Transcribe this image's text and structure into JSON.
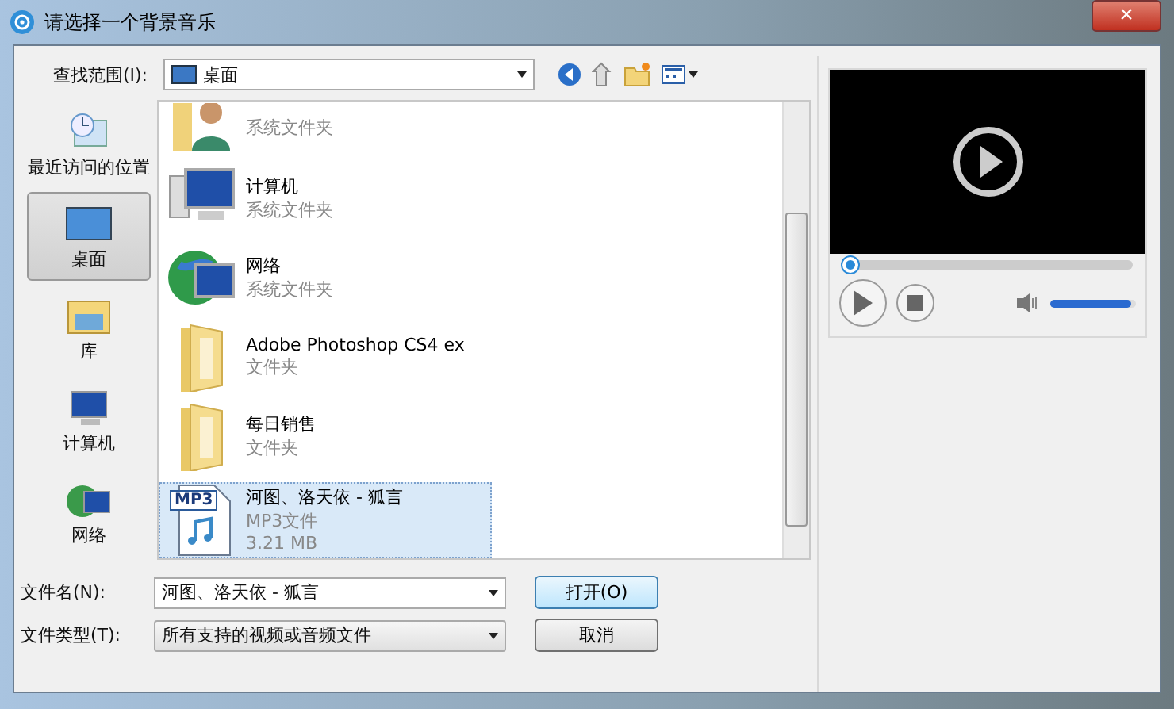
{
  "window": {
    "title": "请选择一个背景音乐",
    "close": "×"
  },
  "look_in": {
    "label": "查找范围(I):",
    "value": "桌面"
  },
  "sidebar": {
    "items": [
      {
        "label": "最近访问的位置",
        "kind": "recent",
        "selected": false
      },
      {
        "label": "桌面",
        "kind": "desktop",
        "selected": true
      },
      {
        "label": "库",
        "kind": "library",
        "selected": false
      },
      {
        "label": "计算机",
        "kind": "computer",
        "selected": false
      },
      {
        "label": "网络",
        "kind": "network",
        "selected": false
      }
    ]
  },
  "files": [
    {
      "kind": "user",
      "subtitle": "系统文件夹",
      "selected": false
    },
    {
      "kind": "computer",
      "name": "计算机",
      "subtitle": "系统文件夹",
      "selected": false
    },
    {
      "kind": "network",
      "name": "网络",
      "subtitle": "系统文件夹",
      "selected": false
    },
    {
      "kind": "folder",
      "name": "Adobe Photoshop CS4 ex",
      "subtitle": "文件夹",
      "selected": false
    },
    {
      "kind": "folder",
      "name": "每日销售",
      "subtitle": "文件夹",
      "selected": false
    },
    {
      "kind": "mp3",
      "name": "河图、洛天依 - 狐言",
      "subtitle": "MP3文件",
      "size": "3.21 MB",
      "badge": "MP3",
      "selected": true
    }
  ],
  "file_name": {
    "label": "文件名(N):",
    "value": "河图、洛天依 - 狐言"
  },
  "file_type": {
    "label": "文件类型(T):",
    "value": "所有支持的视频或音频文件"
  },
  "buttons": [
    "打开(O)",
    "取消"
  ],
  "player": {
    "progress": {
      "level": 0
    },
    "volume": {
      "level": 0.95
    }
  }
}
